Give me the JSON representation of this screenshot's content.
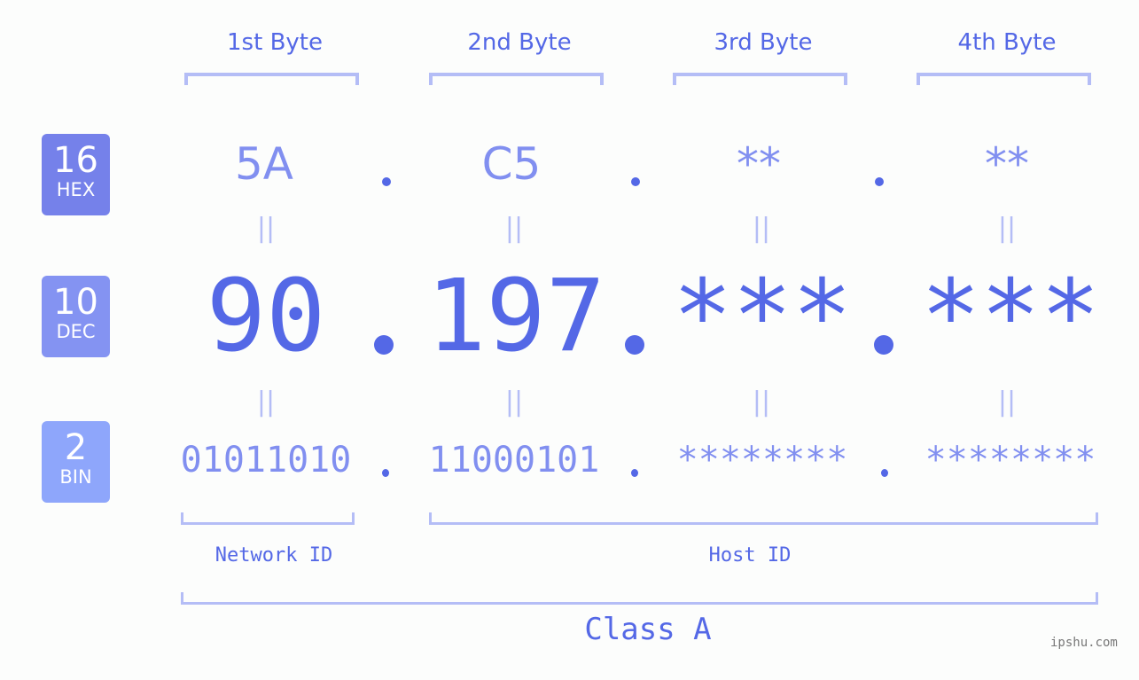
{
  "bytes": {
    "headers": [
      "1st Byte",
      "2nd Byte",
      "3rd Byte",
      "4th Byte"
    ],
    "hex": [
      "5A",
      "C5",
      "**",
      "**"
    ],
    "dec": [
      "90",
      "197",
      "***",
      "***"
    ],
    "bin": [
      "01011010",
      "11000101",
      "********",
      "********"
    ],
    "equals": "||"
  },
  "badges": {
    "hex": {
      "number": "16",
      "label": "HEX",
      "color": "#7581ea"
    },
    "dec": {
      "number": "10",
      "label": "DEC",
      "color": "#8493f2"
    },
    "bin": {
      "number": "2",
      "label": "BIN",
      "color": "#8ea6fb"
    }
  },
  "segments": {
    "network": "Network ID",
    "host": "Host ID",
    "class": "Class A"
  },
  "watermark": "ipshu.com",
  "colors": {
    "primary": "#5468e6",
    "secondary": "#818ff0",
    "bracket": "#b4bdf6",
    "background": "#fcfdfc"
  }
}
